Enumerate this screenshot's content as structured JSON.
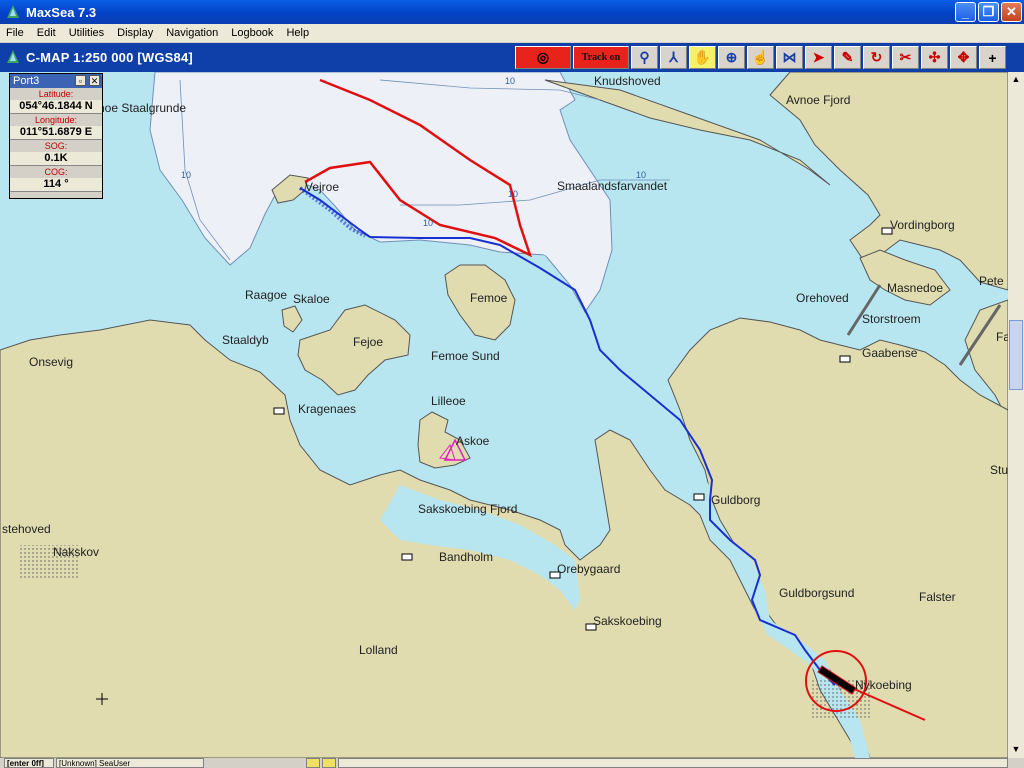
{
  "window": {
    "title": "MaxSea 7.3"
  },
  "menu": [
    "File",
    "Edit",
    "Utilities",
    "Display",
    "Navigation",
    "Logbook",
    "Help"
  ],
  "chart": {
    "title": "C-MAP  1:250 000 [WGS84]"
  },
  "toolbar": {
    "track_label": "Track on"
  },
  "info_panel": {
    "name": "Port3",
    "latitude_label": "Latitude:",
    "latitude": "054°46.1844 N",
    "longitude_label": "Longitude:",
    "longitude": "011°51.6879 E",
    "sog_label": "SOG:",
    "sog": "0.1K",
    "cog_label": "COG:",
    "cog": "114 °"
  },
  "places": {
    "knudshoved": "Knudshoved",
    "avnoe_fjord": "Avnoe Fjord",
    "staalgrunde": "noe Staalgrunde",
    "smaalandsfarvandet": "Smaalandsfarvandet",
    "vordingborg": "Vordingborg",
    "pete": "Pete",
    "masnedoe": "Masnedoe",
    "orehoved": "Orehoved",
    "storstroem": "Storstroem",
    "gaabense": "Gaabense",
    "fa": "Fa",
    "vejroe": "Vejroe",
    "raagoe": "Raagoe",
    "skaloe": "Skaloe",
    "femoe": "Femoe",
    "staaldyb": "Staaldyb",
    "fejoe": "Fejoe",
    "onsevig": "Onsevig",
    "femoe_sund": "Femoe Sund",
    "lilleoe": "Lilleoe",
    "kragenaes": "Kragenaes",
    "askoe": "Askoe",
    "stu": "Stu",
    "guldborg": "Guldborg",
    "sakskoebing_fjord": "Sakskoebing Fjord",
    "stehoved": "stehoved",
    "nakskov": "Nakskov",
    "bandholm": "Bandholm",
    "orebygaard": "Orebygaard",
    "guldborgsund": "Guldborgsund",
    "falster": "Falster",
    "sakskoebing": "Sakskoebing",
    "lolland": "Lolland",
    "nykoebing": "Nykoebing"
  },
  "depth_labels": [
    "10",
    "10",
    "10",
    "10",
    "10"
  ],
  "statusbar": {
    "mode": "[enter 0ff]",
    "user": "[Unknown] SeaUser"
  },
  "colors": {
    "land": "#e0dcb0",
    "sea": "#b8e6f0",
    "shallow": "#eef0f8",
    "route": "#e01010",
    "track": "#1830d0"
  }
}
